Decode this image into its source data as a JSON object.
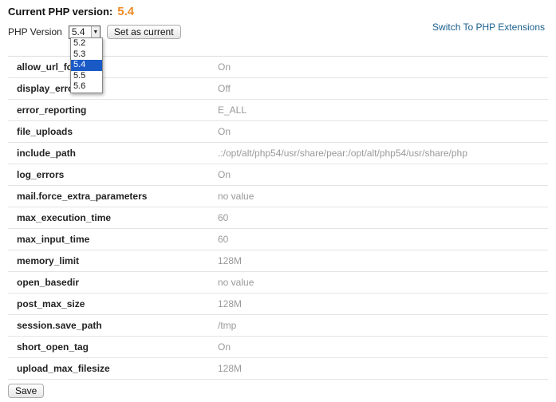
{
  "header": {
    "current_label": "Current PHP version:",
    "current_version": "5.4",
    "version_label": "PHP Version",
    "selected_version": "5.4",
    "set_current_label": "Set as current",
    "switch_link": "Switch To PHP Extensions"
  },
  "dropdown": {
    "options": [
      "5.2",
      "5.3",
      "5.4",
      "5.5",
      "5.6"
    ],
    "selected": "5.4"
  },
  "settings": [
    {
      "name": "allow_url_fopen",
      "value": "On"
    },
    {
      "name": "display_errors",
      "value": "Off"
    },
    {
      "name": "error_reporting",
      "value": "E_ALL"
    },
    {
      "name": "file_uploads",
      "value": "On"
    },
    {
      "name": "include_path",
      "value": ".:/opt/alt/php54/usr/share/pear:/opt/alt/php54/usr/share/php"
    },
    {
      "name": "log_errors",
      "value": "On"
    },
    {
      "name": "mail.force_extra_parameters",
      "value": "no value"
    },
    {
      "name": "max_execution_time",
      "value": "60"
    },
    {
      "name": "max_input_time",
      "value": "60"
    },
    {
      "name": "memory_limit",
      "value": "128M"
    },
    {
      "name": "open_basedir",
      "value": "no value"
    },
    {
      "name": "post_max_size",
      "value": "128M"
    },
    {
      "name": "session.save_path",
      "value": "/tmp"
    },
    {
      "name": "short_open_tag",
      "value": "On"
    },
    {
      "name": "upload_max_filesize",
      "value": "128M"
    }
  ],
  "footer": {
    "save_label": "Save"
  },
  "colors": {
    "version_accent": "#f08a24",
    "link": "#1a5e8c",
    "selection": "#1a5ac7"
  }
}
